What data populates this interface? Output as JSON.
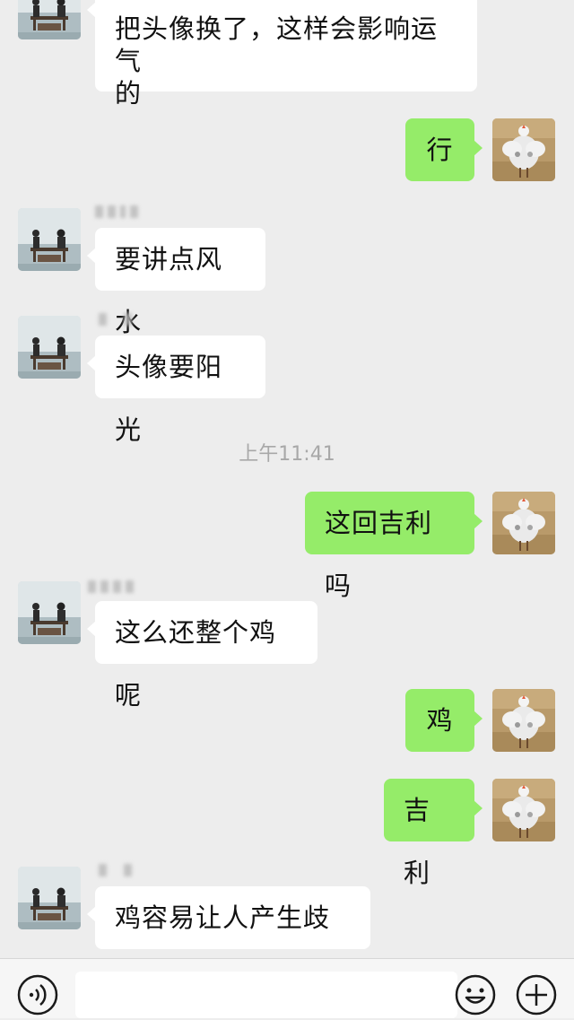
{
  "messages": [
    {
      "id": "m1",
      "dir": "in",
      "text": "把头像换了，这样会影响运气的"
    },
    {
      "id": "m2",
      "dir": "out",
      "text": "行"
    },
    {
      "id": "m3",
      "dir": "in",
      "text": "要讲点风水"
    },
    {
      "id": "m4",
      "dir": "in",
      "text": "头像要阳光"
    },
    {
      "id": "m5",
      "dir": "out",
      "text": "这回吉利吗"
    },
    {
      "id": "m6",
      "dir": "in",
      "text": "这么还整个鸡呢"
    },
    {
      "id": "m7",
      "dir": "out",
      "text": "鸡"
    },
    {
      "id": "m8",
      "dir": "out",
      "text": "吉利"
    },
    {
      "id": "m9",
      "dir": "in",
      "text": "鸡容易让人产生歧义"
    }
  ],
  "timestamp": "上午11:41",
  "m1_line1": "把头像换了，这样会影响运气",
  "m1_line2": "的",
  "input_bar": {
    "voice_icon": "voice-icon",
    "emoji_icon": "emoji-icon",
    "plus_icon": "plus-icon"
  },
  "colors": {
    "background": "#ededed",
    "incoming_bubble": "#ffffff",
    "outgoing_bubble": "#95ec69"
  }
}
